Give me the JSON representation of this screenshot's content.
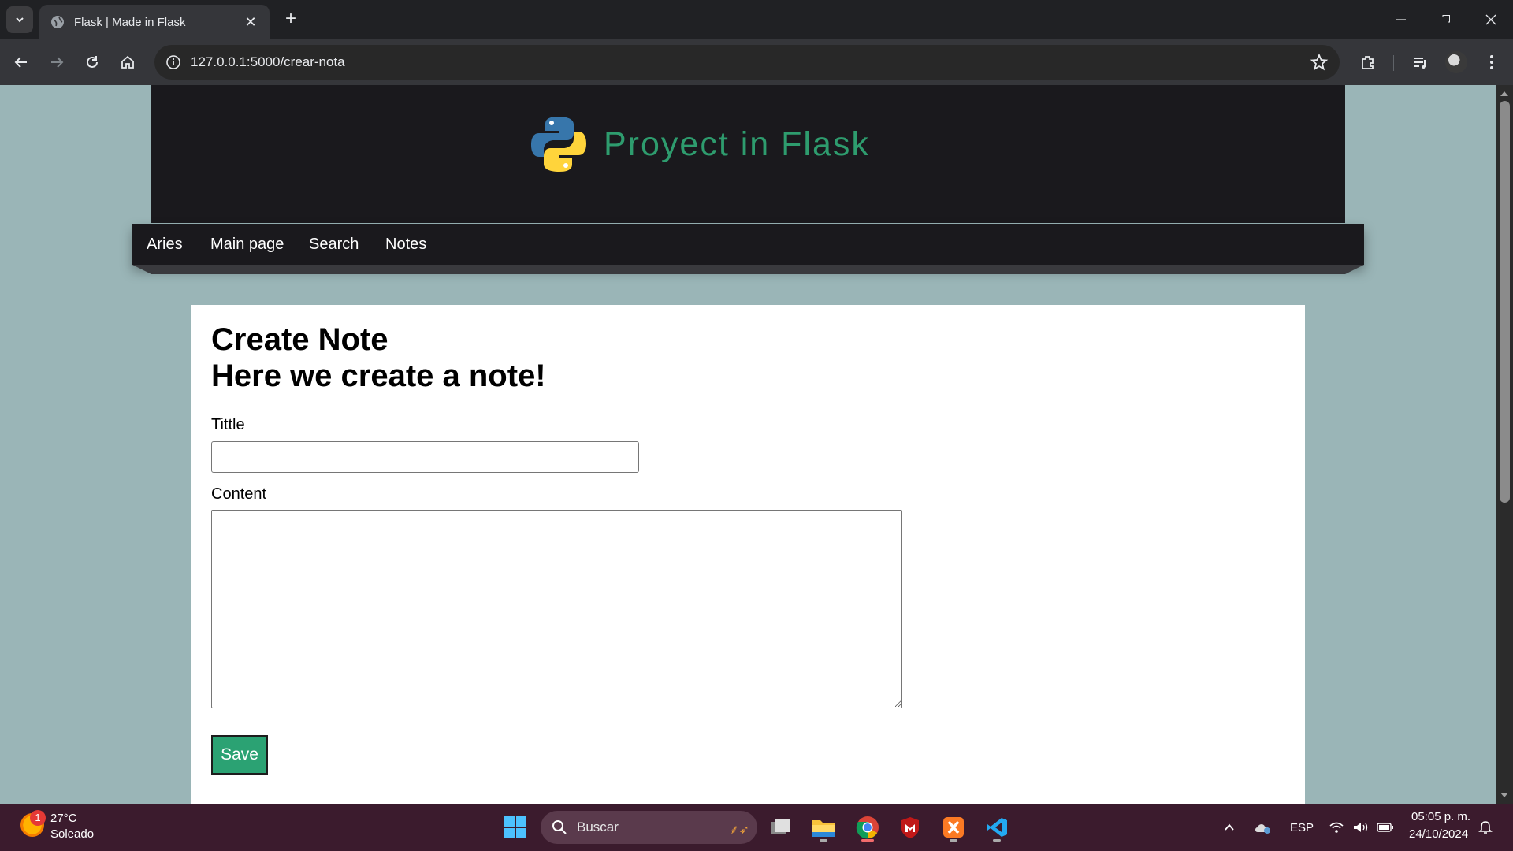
{
  "browser": {
    "tab_title": "Flask | Made in Flask",
    "url": "127.0.0.1:5000/crear-nota"
  },
  "site": {
    "title": "Proyect in Flask",
    "nav": [
      "Aries",
      "Main page",
      "Search",
      "Notes"
    ]
  },
  "form": {
    "heading": "Create Note",
    "subheading": "Here we create a note!",
    "title_label": "Tittle",
    "title_value": "",
    "content_label": "Content",
    "content_value": "",
    "save_label": "Save"
  },
  "taskbar": {
    "weather_temp": "27°C",
    "weather_desc": "Soleado",
    "weather_badge": "1",
    "search_placeholder": "Buscar",
    "language": "ESP",
    "time": "05:05 p. m.",
    "date": "24/10/2024"
  },
  "colors": {
    "page_bg": "#9ab5b7",
    "header_bg": "#1a191d",
    "title_green": "#2e9c6e",
    "save_green": "#2ba273",
    "taskbar_bg": "#3b1b2d"
  },
  "icons": [
    "tab-search-icon",
    "globe-icon",
    "close-icon",
    "plus-icon",
    "minimize-icon",
    "maximize-icon",
    "back-icon",
    "forward-icon",
    "reload-icon",
    "home-icon",
    "info-icon",
    "star-icon",
    "extensions-icon",
    "media-icon",
    "menu-icon",
    "python-logo",
    "windows-start-icon",
    "search-icon",
    "file-explorer-icon",
    "chrome-icon",
    "mcafee-icon",
    "xampp-icon",
    "vscode-icon",
    "chevron-up-icon",
    "cloud-icon",
    "wifi-icon",
    "volume-icon",
    "battery-icon",
    "notification-icon"
  ]
}
